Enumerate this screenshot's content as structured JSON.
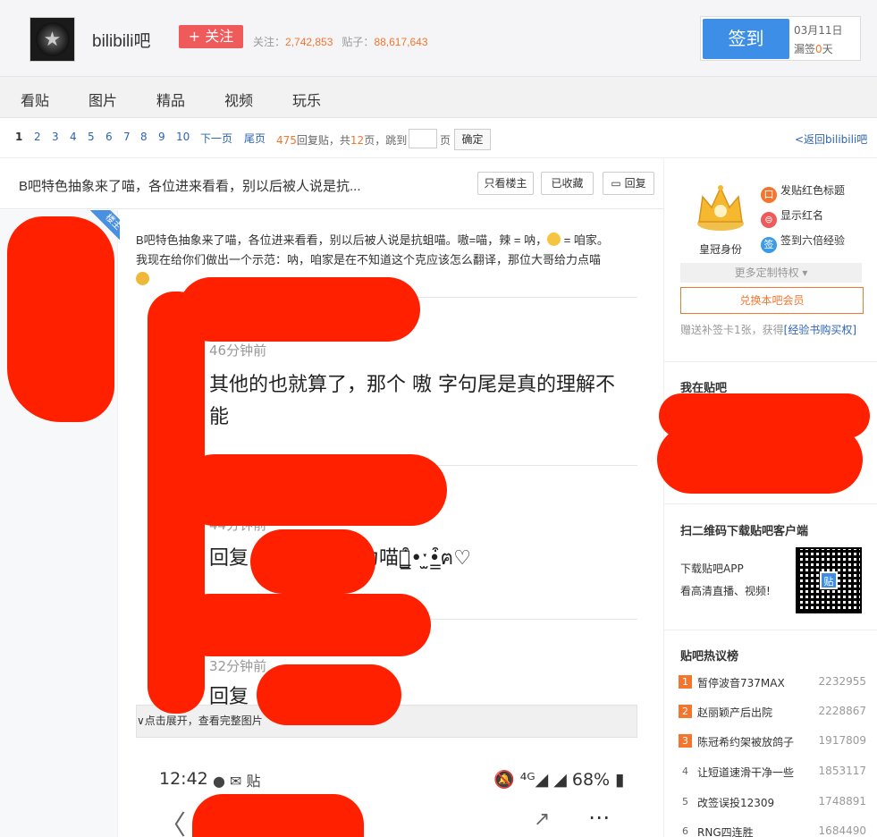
{
  "header": {
    "forum_name": "bilibili吧",
    "follow_label": "+ 关注",
    "follow_count_label": "关注：",
    "follow_count": "2,742,853",
    "post_count_label": "贴子：",
    "post_count": "88,617,643",
    "signin_label": "签到",
    "signin_date": "03月11日",
    "signin_miss_prefix": "漏签",
    "signin_miss_days": "0",
    "signin_miss_suffix": "天"
  },
  "nav": {
    "items": [
      "看贴",
      "图片",
      "精品",
      "视频",
      "玩乐"
    ]
  },
  "pager": {
    "pages": [
      "1",
      "2",
      "3",
      "4",
      "5",
      "6",
      "7",
      "8",
      "9",
      "10"
    ],
    "next_label": "下一页",
    "last_label": "尾页",
    "reply_count": "475",
    "reply_label": "回复贴，共",
    "page_total": "12",
    "page_total_suffix": "页，",
    "jump_label": "跳到",
    "jump_suffix": "页",
    "ok_label": "确定",
    "back_label": "<返回bilibili吧"
  },
  "thread": {
    "title": "B吧特色抽象来了喵，各位进来看看，别以后被人说是抗...",
    "only_lz_label": "只看楼主",
    "collected_label": "已收藏",
    "reply_label": "回复",
    "lz_badge": "楼主",
    "body_line1": "B吧特色抽象来了喵，各位进来看看，别以后被人说是抗蛆喵。嗷=喵，辣 = 呐，",
    "body_line1_tail": " = 咱家。",
    "body_line2": "我现在给你们做出一个示范：呐，咱家是在不知道这个克应该怎么翻译，那位大哥给力点喵",
    "comments": [
      {
        "time": "46分钟前",
        "text": "其他的也就算了，那个 嗷 字句尾是真的理解不能"
      },
      {
        "time": "44分钟前",
        "text": "回复                     嗷 可以理解为喵ฅ̳͒•ˑ̫•̳͒ฅ♡"
      },
      {
        "time": "32分钟前",
        "text": "回复                         ·(≥^_^≤)喵~"
      }
    ],
    "expand_label": "∨点击展开，查看完整图片",
    "phone": {
      "time": "12:42",
      "icons": "● ✉ 贴",
      "battery": "🔕 ⁴ᴳ◢ ◢ 68% ▮",
      "back": "〈",
      "share": "↗",
      "more": "⋯"
    }
  },
  "sidebar": {
    "crown_label": "皇冠身份",
    "privileges": [
      {
        "icon": "口",
        "color": "#f4752d",
        "label": "发贴红色标题"
      },
      {
        "icon": "⊜",
        "color": "#ef5a5a",
        "label": "显示红名"
      },
      {
        "icon": "签",
        "color": "#3c9be6",
        "label": "签到六倍经验"
      }
    ],
    "more_priv_label": "更多定制特权 ▾",
    "member_btn_label": "兑换本吧会员",
    "bonus_text": "赠送补签卡1张，获得",
    "bonus_link": "[经验书购买权]",
    "my_forum_title": "我在贴吧",
    "qr_title": "扫二维码下载贴吧客户端",
    "qr_line1": "下载贴吧APP",
    "qr_line2": "看高清直播、视频!",
    "qr_center": "贴",
    "hot_title": "贴吧热议榜",
    "hot_items": [
      {
        "rank": "1",
        "title": "暂停波音737MAX",
        "value": "2232955"
      },
      {
        "rank": "2",
        "title": "赵丽颖产后出院",
        "value": "2228867"
      },
      {
        "rank": "3",
        "title": "陈冠希约架被放鸽子",
        "value": "1917809"
      },
      {
        "rank": "4",
        "title": "让短道速滑干净一些",
        "value": "1853117"
      },
      {
        "rank": "5",
        "title": "改签误投12309",
        "value": "1748891"
      },
      {
        "rank": "6",
        "title": "RNG四连胜",
        "value": "1684490"
      }
    ],
    "colors": {
      "rank_hot": "#f4752d",
      "accent": "#3c8ee6"
    }
  }
}
